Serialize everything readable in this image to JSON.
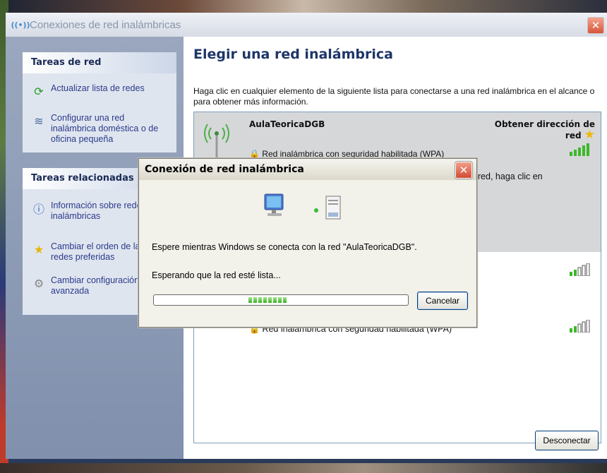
{
  "window": {
    "title": "Conexiones de red inalámbricas",
    "close_label": "✕"
  },
  "sidebar": {
    "network_tasks": {
      "header": "Tareas de red",
      "items": [
        {
          "label": "Actualizar lista de redes",
          "icon": "refresh-icon"
        },
        {
          "label": "Configurar una red inalámbrica doméstica o de oficina pequeña",
          "icon": "wireless-setup-icon"
        }
      ]
    },
    "related_tasks": {
      "header": "Tareas relacionadas",
      "items": [
        {
          "label": "Información sobre redes inalámbricas",
          "icon": "info-icon"
        },
        {
          "label": "Cambiar el orden de las redes preferidas",
          "icon": "star-icon"
        },
        {
          "label": "Cambiar configuración avanzada",
          "icon": "settings-icon"
        }
      ]
    }
  },
  "main": {
    "title": "Elegir una red inalámbrica",
    "intro": "Haga clic en cualquier elemento de la siguiente lista para conectarse a una red inalámbrica en el alcance o para obtener más información.",
    "networks": [
      {
        "name": "AulaTeoricaDGB",
        "status": "Obtener dirección de red",
        "security": "Red inalámbrica con seguridad habilitada (WPA)",
        "hint": "ta red, haga clic en",
        "selected": true
      },
      {
        "security": "Red inalámbrica con seguridad habilitada (WPA)"
      }
    ],
    "disconnect_label": "Desconectar"
  },
  "dialog": {
    "title": "Conexión de red inalámbrica",
    "message": "Espere mientras Windows se conecta con la red \"AulaTeoricaDGB\".",
    "waiting": "Esperando que la red esté lista...",
    "cancel_label": "Cancelar",
    "close_label": "✕"
  },
  "colors": {
    "accent": "#1d3568",
    "sidebar_bg": "#8090ad",
    "selected_row": "#d6d7d9",
    "progress": "#37b021"
  }
}
